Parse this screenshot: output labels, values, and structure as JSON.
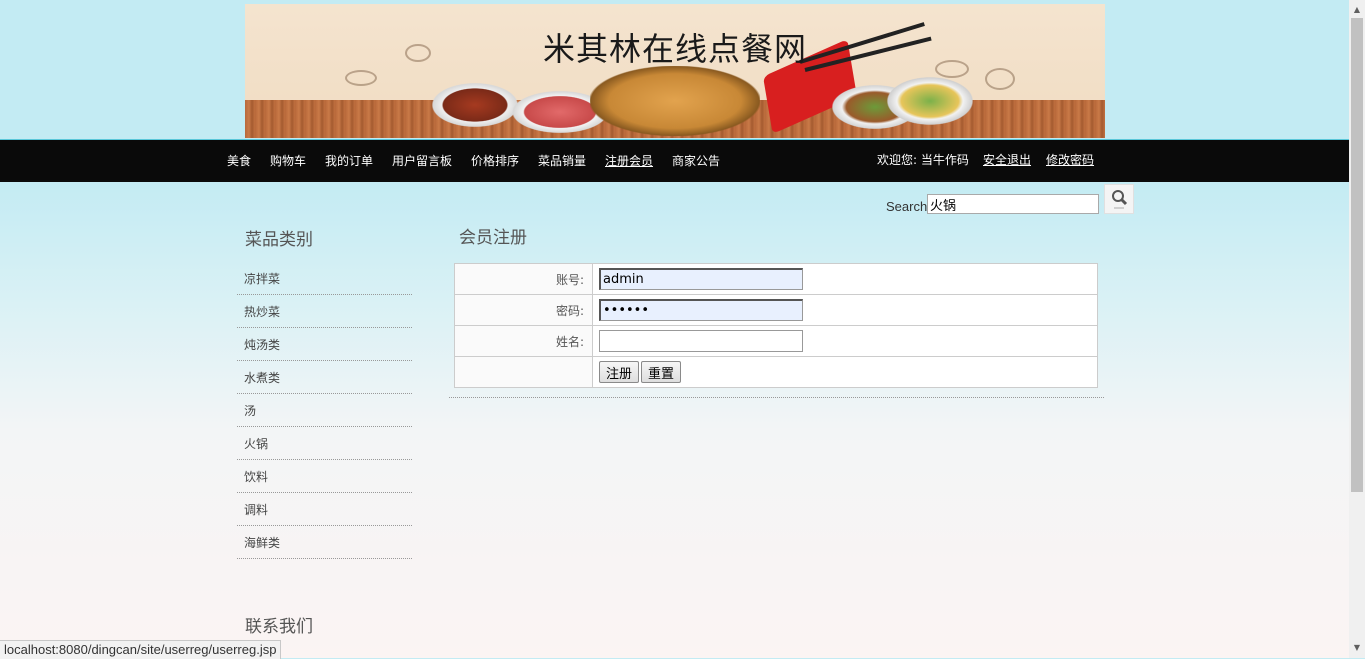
{
  "banner": {
    "title": "米其林在线点餐网"
  },
  "nav": {
    "items": [
      {
        "label": "美食"
      },
      {
        "label": "购物车"
      },
      {
        "label": "我的订单"
      },
      {
        "label": "用户留言板"
      },
      {
        "label": "价格排序"
      },
      {
        "label": "菜品销量"
      },
      {
        "label": "注册会员"
      },
      {
        "label": "商家公告"
      }
    ],
    "welcome": "欢迎您:  当牛作码",
    "logout": "安全退出",
    "change_password": "修改密码"
  },
  "search": {
    "label": "Search",
    "value": "火锅",
    "icon": "search-icon"
  },
  "sidebar": {
    "categories_heading": "菜品类别",
    "categories": [
      {
        "label": "凉拌菜"
      },
      {
        "label": "热炒菜"
      },
      {
        "label": "炖汤类"
      },
      {
        "label": "水煮类"
      },
      {
        "label": "汤"
      },
      {
        "label": "火锅"
      },
      {
        "label": "饮料"
      },
      {
        "label": "调料"
      },
      {
        "label": "海鲜类"
      }
    ],
    "contact_heading": "联系我们"
  },
  "form": {
    "heading": "会员注册",
    "account_label": "账号:",
    "account_value": "admin",
    "password_label": "密码:",
    "password_value": "••••••",
    "name_label": "姓名:",
    "name_value": "",
    "register_button": "注册",
    "reset_button": "重置"
  },
  "status_url": "localhost:8080/dingcan/site/userreg/userreg.jsp",
  "colors": {
    "navbar_bg": "#0a0a0a",
    "page_top": "#c3ebf3",
    "page_bottom": "#fbf4f3"
  }
}
